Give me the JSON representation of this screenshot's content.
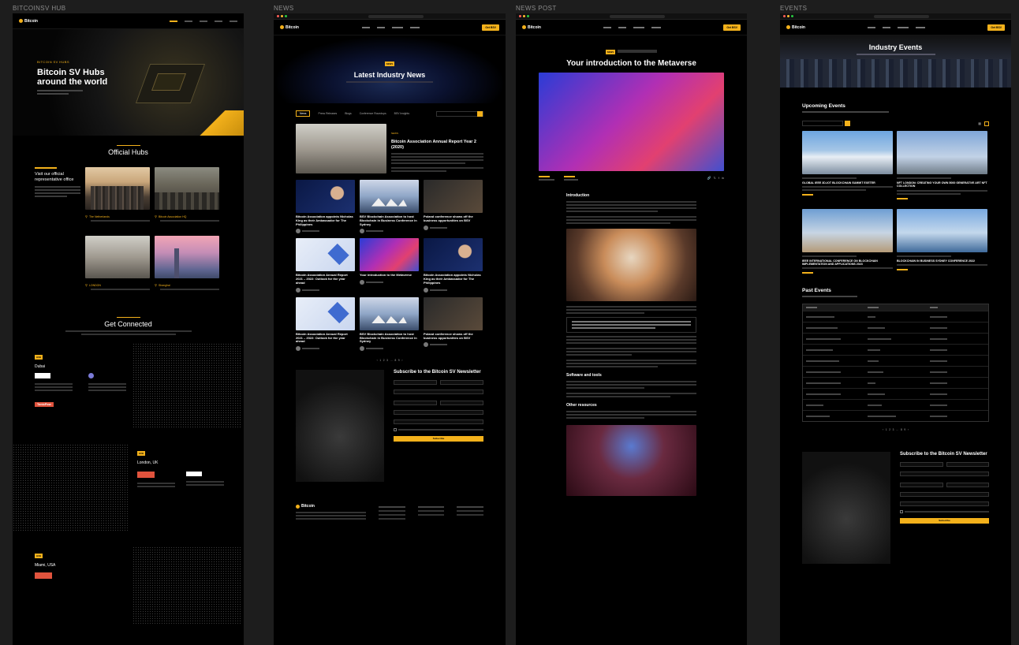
{
  "frames": {
    "hub": {
      "label": "BITCOINSV HUB",
      "nav": {
        "logo": "Bitcoin"
      },
      "hero": {
        "eyebrow": "BITCOIN SV HUBS",
        "title_line1": "Bitcoin SV Hubs",
        "title_line2": "around the world"
      },
      "official_hubs": {
        "title": "Official Hubs",
        "side_title": "Visit our official representative office",
        "hubs": [
          {
            "city": "The Netherlands"
          },
          {
            "city": "Bitcoin Association HQ"
          },
          {
            "city": "LONDON"
          },
          {
            "city": "Shanghai"
          }
        ]
      },
      "get_connected": {
        "title": "Get Connected",
        "cities": [
          {
            "name": "Dubai"
          },
          {
            "name": "London, UK"
          },
          {
            "name": "Miami, USA"
          }
        ],
        "sponsor": "TonicPow"
      }
    },
    "news": {
      "label": "NEWS",
      "nav": {
        "logo": "Bitcoin",
        "cta": "Get BSV"
      },
      "hero_title": "Latest Industry News",
      "tabs": [
        "News",
        "Press Releases",
        "Blogs",
        "Conference Roundups",
        "BSV Insights"
      ],
      "featured": {
        "tag": "NEWS",
        "title": "Bitcoin Association Annual Report Year 2 (2020)"
      },
      "cards": [
        {
          "title": "Bitcoin Association appoints Nicholas King as their Ambassador for The Philippines"
        },
        {
          "title": "BSV Blockchain Association to host Blockchain in Business Conference in Sydney"
        },
        {
          "title": "Poland conference shows off the business opportunities on BSV"
        },
        {
          "title": "Bitcoin Association Annual Report 2021 – 2022: Outlook for the year ahead"
        },
        {
          "title": "Your introduction to the Metaverse"
        },
        {
          "title": "Bitcoin Association appoints Nicholas King as their Ambassador for The Philippines"
        },
        {
          "title": "Bitcoin Association Annual Report 2021 – 2022: Outlook for the year ahead"
        },
        {
          "title": "BSV Blockchain Association to host Blockchain in Business Conference in Sydney"
        },
        {
          "title": "Poland conference shows off the business opportunities on BSV"
        }
      ],
      "newsletter": {
        "title": "Subscribe to the Bitcoin SV Newsletter",
        "button": "Subscribe"
      }
    },
    "post": {
      "label": "NEWS POST",
      "nav": {
        "logo": "Bitcoin",
        "cta": "Get BSV"
      },
      "title": "Your introduction to the Metaverse",
      "headings": [
        "Introduction",
        "Software and tools",
        "Other resources"
      ]
    },
    "events": {
      "label": "EVENTS",
      "nav": {
        "logo": "Bitcoin",
        "cta": "Get BSV"
      },
      "hero_title": "Industry Events",
      "upcoming_title": "Upcoming Events",
      "events": [
        {
          "title": "GLOBAL IEEE 3D-IOT BLOCKCHAIN SUMMIT EXETER"
        },
        {
          "title": "NFT LONDON: CREATING YOUR OWN 5000 GENERATIVE ART NFT COLLECTION"
        },
        {
          "title": "IEEE INTERNATIONAL CONFERENCE ON BLOCKCHAIN IMPLEMENTATION AND APPLICATIONS 2023"
        },
        {
          "title": "BLOCKCHAIN IN BUSINESS SYDNEY CONFERENCE 2022"
        }
      ],
      "past_title": "Past Events",
      "newsletter_title": "Subscribe to the Bitcoin SV Newsletter"
    }
  },
  "colors": {
    "accent": "#f3b11b",
    "background": "#000000"
  }
}
